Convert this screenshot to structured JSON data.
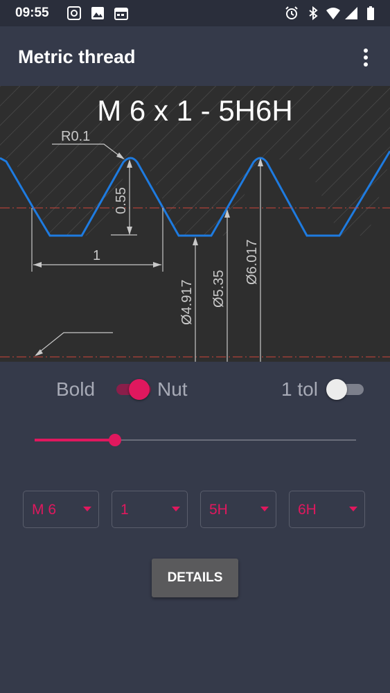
{
  "status_bar": {
    "time": "09:55"
  },
  "app_bar": {
    "title": "Metric thread"
  },
  "drawing": {
    "thread_designation": "M 6 x 1 - 5H6H",
    "radius_label": "R0.1",
    "height_label": "0.55",
    "pitch_label": "1",
    "dim_minor": "Ø4.917",
    "dim_pitch": "Ø5.35",
    "dim_major": "Ø6.017",
    "colors": {
      "profile": "#1e7be0",
      "axis_line": "#d0453a",
      "dimension": "#c8c8c8"
    }
  },
  "controls": {
    "bold_label": "Bold",
    "nut_label": "Nut",
    "nut_on": true,
    "tol_label": "1 tol",
    "tol_on": false,
    "slider_fraction": 0.25
  },
  "dropdowns": [
    {
      "value": "M 6"
    },
    {
      "value": "1"
    },
    {
      "value": "5H"
    },
    {
      "value": "6H"
    }
  ],
  "details_button": "DETAILS",
  "accent_color": "#e0185e"
}
